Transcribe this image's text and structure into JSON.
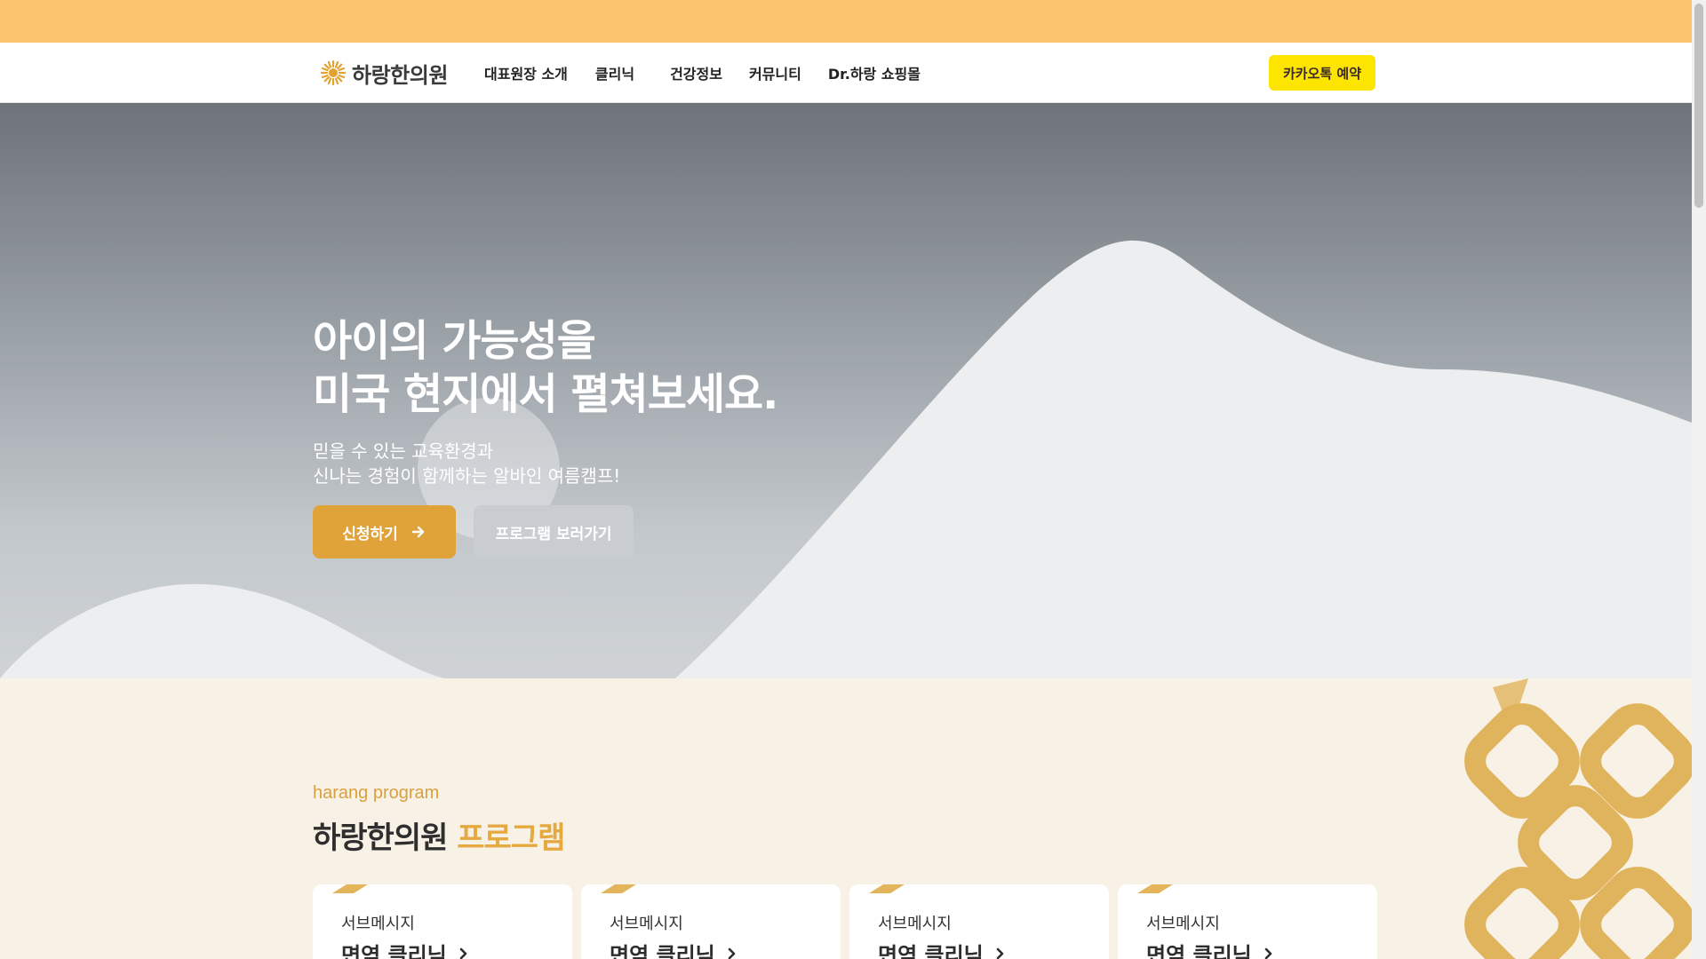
{
  "header": {
    "logo_text": "하랑한의원",
    "nav": [
      "대표원장 소개",
      "클리닉",
      "건강정보",
      "커뮤니티",
      "Dr.하랑 쇼핑몰"
    ],
    "kakao_label": "카카오톡 예약"
  },
  "hero": {
    "title_line1": "아이의 가능성을",
    "title_line2": "미국 현지에서 펼쳐보세요.",
    "sub_line1": "믿을 수 있는 교육환경과",
    "sub_line2": "신나는 경험이 함께하는 알바인 여름캠프!",
    "apply_label": "신청하기",
    "program_label": "프로그램 보러가기"
  },
  "program": {
    "kicker": "harang program",
    "title_main": "하랑한의원",
    "title_accent": "프로그램",
    "cards": [
      {
        "sub": "서브메시지",
        "title": "면역 클리닉"
      },
      {
        "sub": "서브메시지",
        "title": "면역 클리닉"
      },
      {
        "sub": "서브메시지",
        "title": "면역 클리닉"
      },
      {
        "sub": "서브메시지",
        "title": "면역 클리닉"
      }
    ]
  },
  "colors": {
    "topbar": "#fcc46f",
    "accent": "#e0a33a",
    "kakao": "#fee500",
    "section_bg": "#f8f1e6"
  },
  "icons": {
    "logo": "sunflower-logo-icon",
    "arrow": "arrow-right-icon",
    "chevron": "chevron-right-icon"
  }
}
